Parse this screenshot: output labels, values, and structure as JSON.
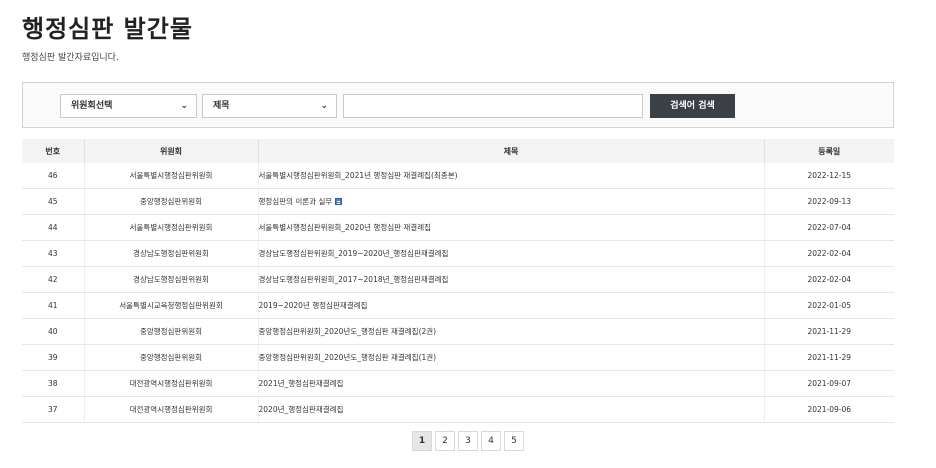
{
  "header": {
    "title": "행정심판 발간물",
    "subtitle": "행정심판 발간자료입니다."
  },
  "search": {
    "committee_select": "위원회선택",
    "field_select": "제목",
    "query_value": "",
    "button_label": "검색어 검색"
  },
  "table": {
    "columns": [
      "번호",
      "위원회",
      "제목",
      "등록일"
    ],
    "rows": [
      {
        "no": "46",
        "committee": "서울특별시행정심판위원회",
        "title": "서울특별시행정심판위원회_2021년 행정심판 재결례집(최종본)",
        "date": "2022-12-15",
        "has_attachment_icon": false
      },
      {
        "no": "45",
        "committee": "중앙행정심판위원회",
        "title": "행정심판의 이론과 실무",
        "date": "2022-09-13",
        "has_attachment_icon": true
      },
      {
        "no": "44",
        "committee": "서울특별시행정심판위원회",
        "title": "서울특별시행정심판위원회_2020년 행정심판 재결례집",
        "date": "2022-07-04",
        "has_attachment_icon": false
      },
      {
        "no": "43",
        "committee": "경상남도행정심판위원회",
        "title": "경상남도행정심판위원회_2019~2020년_행정심판재결례집",
        "date": "2022-02-04",
        "has_attachment_icon": false
      },
      {
        "no": "42",
        "committee": "경상남도행정심판위원회",
        "title": "경상남도행정심판위원회_2017~2018년_행정심판재결례집",
        "date": "2022-02-04",
        "has_attachment_icon": false
      },
      {
        "no": "41",
        "committee": "서울특별시교육청행정심판위원회",
        "title": "2019~2020년 행정심판재결례집",
        "date": "2022-01-05",
        "has_attachment_icon": false
      },
      {
        "no": "40",
        "committee": "중앙행정심판위원회",
        "title": "중앙행정심판위원회_2020년도_행정심판 재결례집(2권)",
        "date": "2021-11-29",
        "has_attachment_icon": false
      },
      {
        "no": "39",
        "committee": "중앙행정심판위원회",
        "title": "중앙행정심판위원회_2020년도_행정심판 재결례집(1권)",
        "date": "2021-11-29",
        "has_attachment_icon": false
      },
      {
        "no": "38",
        "committee": "대전광역시행정심판위원회",
        "title": "2021년_행정심판재결례집",
        "date": "2021-09-07",
        "has_attachment_icon": false
      },
      {
        "no": "37",
        "committee": "대전광역시행정심판위원회",
        "title": "2020년_행정심판재결례집",
        "date": "2021-09-06",
        "has_attachment_icon": false
      }
    ]
  },
  "pagination": {
    "pages": [
      "1",
      "2",
      "3",
      "4",
      "5"
    ],
    "current": "1"
  }
}
